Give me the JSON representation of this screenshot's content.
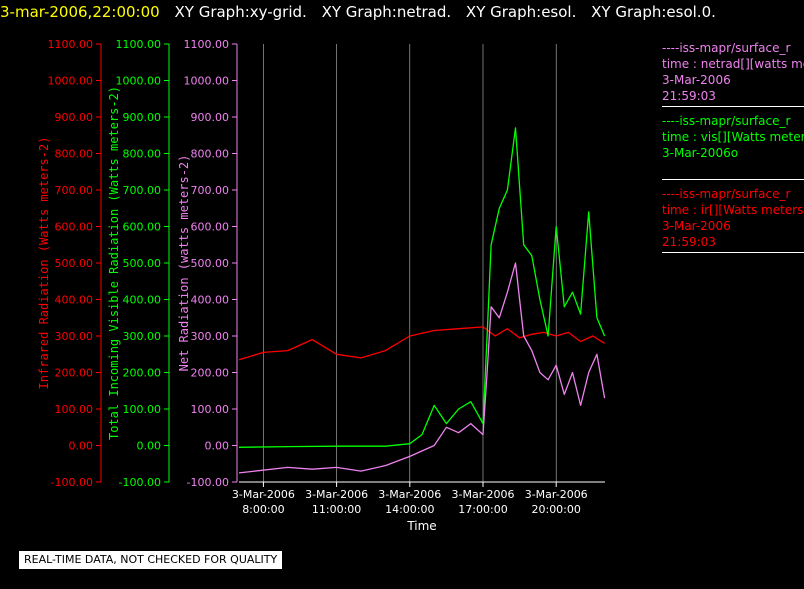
{
  "header": {
    "timestamp": "3-mar-2006,22:00:00",
    "titles": [
      "XY Graph:xy-grid.",
      "XY Graph:netrad.",
      "XY Graph:esol.",
      "XY Graph:esol.0."
    ]
  },
  "legend": [
    {
      "lines": [
        "----iss-mapr/surface_r",
        "time : netrad[][watts me",
        "3-Mar-2006",
        "21:59:03"
      ],
      "color": "#ee82ee"
    },
    {
      "lines": [
        "----iss-mapr/surface_r",
        "time : vis[][Watts meter",
        "3-Mar-2006o"
      ],
      "color": "#00ff00"
    },
    {
      "lines": [
        "----iss-mapr/surface_r",
        "time : ir[][Watts meters",
        "3-Mar-2006",
        "21:59:03"
      ],
      "color": "#ff0000"
    }
  ],
  "footer": "REAL-TIME DATA, NOT CHECKED FOR QUALITY",
  "chart_data": {
    "type": "line",
    "xlabel": "Time",
    "x_ticks": [
      {
        "date": "3-Mar-2006",
        "time": "8:00:00",
        "hour": 8
      },
      {
        "date": "3-Mar-2006",
        "time": "11:00:00",
        "hour": 11
      },
      {
        "date": "3-Mar-2006",
        "time": "14:00:00",
        "hour": 14
      },
      {
        "date": "3-Mar-2006",
        "time": "17:00:00",
        "hour": 17
      },
      {
        "date": "3-Mar-2006",
        "time": "20:00:00",
        "hour": 20
      }
    ],
    "xlim": [
      "3-Mar-2006 7:00",
      "3-Mar-2006 22:00"
    ],
    "ylim": [
      -100,
      1100
    ],
    "y_ticks": [
      "-100.00",
      "0.00",
      "100.00",
      "200.00",
      "300.00",
      "400.00",
      "500.00",
      "600.00",
      "700.00",
      "800.00",
      "900.00",
      "1000.00",
      "1100.00"
    ],
    "axes": [
      {
        "label": "Infrared Radiation (Watts meters-2)",
        "color": "#ff0000"
      },
      {
        "label": "Total Incoming Visible Radiation (Watts meters-2)",
        "color": "#00ff00"
      },
      {
        "label": "Net Radiation (watts meters-2)",
        "color": "#ee82ee"
      }
    ],
    "grid": "vertical",
    "series": [
      {
        "color": "#ff0000",
        "x": [
          "3-Mar-2006 7:00",
          "3-Mar-2006 8:00",
          "3-Mar-2006 9:00",
          "3-Mar-2006 10:00",
          "3-Mar-2006 11:00",
          "3-Mar-2006 12:00",
          "3-Mar-2006 13:00",
          "3-Mar-2006 14:00",
          "3-Mar-2006 15:00",
          "3-Mar-2006 16:00",
          "3-Mar-2006 17:00",
          "3-Mar-2006 17:30",
          "3-Mar-2006 18:00",
          "3-Mar-2006 18:30",
          "3-Mar-2006 19:00",
          "3-Mar-2006 19:30",
          "3-Mar-2006 20:00",
          "3-Mar-2006 20:30",
          "3-Mar-2006 21:00",
          "3-Mar-2006 21:30",
          "3-Mar-2006 21:59"
        ],
        "y": [
          235,
          255,
          260,
          290,
          250,
          240,
          260,
          300,
          315,
          320,
          325,
          300,
          320,
          295,
          305,
          310,
          300,
          310,
          285,
          300,
          280
        ]
      },
      {
        "color": "#00ff00",
        "x": [
          "3-Mar-2006 7:00",
          "3-Mar-2006 9:00",
          "3-Mar-2006 11:00",
          "3-Mar-2006 13:00",
          "3-Mar-2006 14:00",
          "3-Mar-2006 14:30",
          "3-Mar-2006 15:00",
          "3-Mar-2006 15:30",
          "3-Mar-2006 15:45",
          "3-Mar-2006 16:00",
          "3-Mar-2006 16:30",
          "3-Mar-2006 17:00",
          "3-Mar-2006 17:10",
          "3-Mar-2006 17:20",
          "3-Mar-2006 17:40",
          "3-Mar-2006 18:00",
          "3-Mar-2006 18:20",
          "3-Mar-2006 18:40",
          "3-Mar-2006 19:00",
          "3-Mar-2006 19:20",
          "3-Mar-2006 19:40",
          "3-Mar-2006 20:00",
          "3-Mar-2006 20:20",
          "3-Mar-2006 20:40",
          "3-Mar-2006 21:00",
          "3-Mar-2006 21:20",
          "3-Mar-2006 21:40",
          "3-Mar-2006 21:59"
        ],
        "y": [
          -5,
          -3,
          -2,
          -2,
          5,
          30,
          110,
          60,
          80,
          100,
          120,
          60,
          300,
          550,
          650,
          700,
          870,
          550,
          520,
          400,
          300,
          600,
          380,
          420,
          360,
          640,
          350,
          300
        ]
      },
      {
        "color": "#ee82ee",
        "x": [
          "3-Mar-2006 7:00",
          "3-Mar-2006 9:00",
          "3-Mar-2006 10:00",
          "3-Mar-2006 11:00",
          "3-Mar-2006 12:00",
          "3-Mar-2006 13:00",
          "3-Mar-2006 14:00",
          "3-Mar-2006 15:00",
          "3-Mar-2006 15:30",
          "3-Mar-2006 16:00",
          "3-Mar-2006 16:30",
          "3-Mar-2006 17:00",
          "3-Mar-2006 17:10",
          "3-Mar-2006 17:20",
          "3-Mar-2006 17:40",
          "3-Mar-2006 18:00",
          "3-Mar-2006 18:20",
          "3-Mar-2006 18:40",
          "3-Mar-2006 19:00",
          "3-Mar-2006 19:20",
          "3-Mar-2006 19:40",
          "3-Mar-2006 20:00",
          "3-Mar-2006 20:20",
          "3-Mar-2006 20:40",
          "3-Mar-2006 21:00",
          "3-Mar-2006 21:20",
          "3-Mar-2006 21:40",
          "3-Mar-2006 21:59"
        ],
        "y": [
          -75,
          -60,
          -65,
          -60,
          -70,
          -55,
          -30,
          0,
          50,
          35,
          60,
          30,
          200,
          380,
          350,
          420,
          500,
          300,
          260,
          200,
          180,
          220,
          140,
          200,
          110,
          200,
          250,
          130
        ]
      }
    ]
  }
}
